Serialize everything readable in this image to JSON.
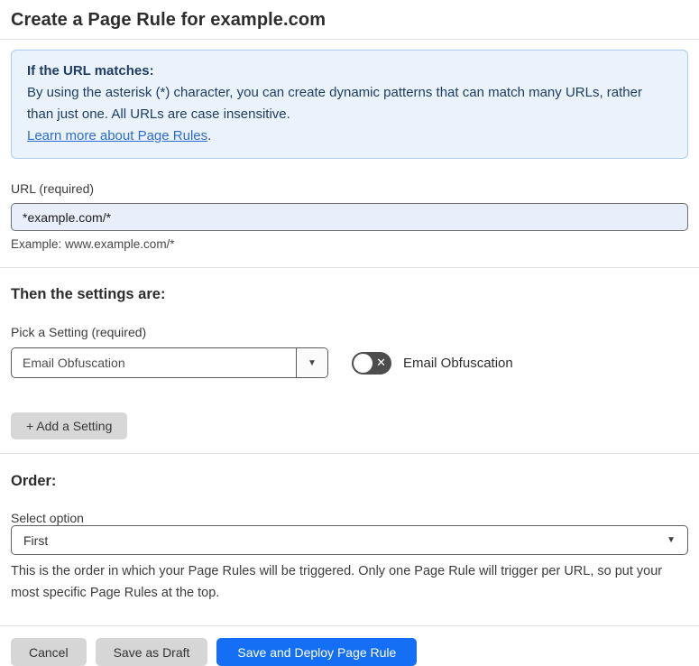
{
  "page": {
    "title": "Create a Page Rule for example.com"
  },
  "info_box": {
    "heading": "If the URL matches:",
    "body": "By using the asterisk (*) character, you can create dynamic patterns that can match many URLs, rather than just one. All URLs are case insensitive.",
    "link": "Learn more about Page Rules",
    "link_suffix": "."
  },
  "url_field": {
    "label": "URL (required)",
    "value": "*example.com/*",
    "example": "Example: www.example.com/*"
  },
  "settings_section": {
    "heading": "Then the settings are:",
    "pick_label": "Pick a Setting (required)",
    "selected_setting": "Email Obfuscation",
    "toggle_label": "Email Obfuscation",
    "toggle_state": "off",
    "add_button_label": "+ Add a Setting"
  },
  "order_section": {
    "heading": "Order:",
    "select_label": "Select option",
    "selected_option": "First",
    "help_text": "This is the order in which your Page Rules will be triggered. Only one Page Rule will trigger per URL, so put your most specific Page Rules at the top."
  },
  "footer": {
    "cancel_label": "Cancel",
    "save_draft_label": "Save as Draft",
    "save_deploy_label": "Save and Deploy Page Rule"
  },
  "icons": {
    "dropdown_arrow": "▼",
    "toggle_off_x": "✕"
  },
  "colors": {
    "info_bg": "#EAF3FC",
    "info_border": "#A8CDEE",
    "info_text": "#1F3C64",
    "link_blue": "#2F6BD0",
    "url_input_bg": "#E9EEFB",
    "primary_button_blue": "#156FF5",
    "gray_button": "#D6D6D6",
    "toggle_off_bg": "#4D4D4D"
  }
}
